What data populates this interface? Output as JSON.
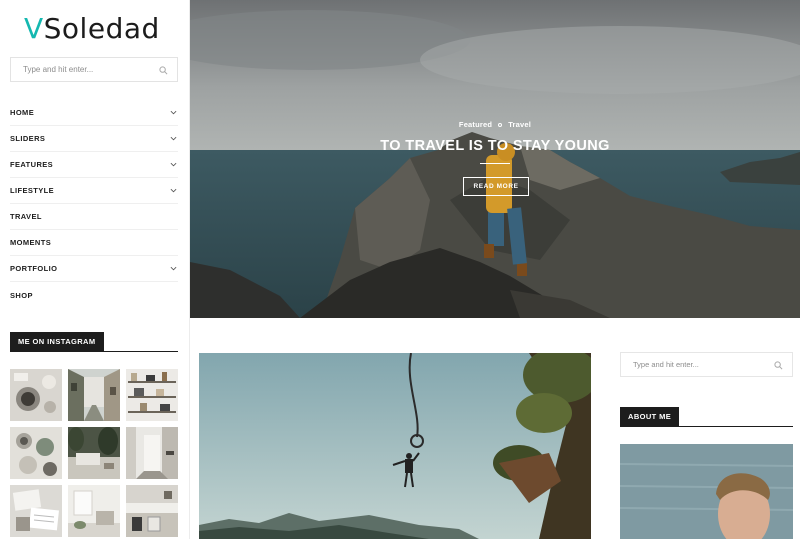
{
  "logo": {
    "first": "V",
    "rest": "Soledad"
  },
  "sidebar": {
    "search_placeholder": "Type and hit enter...",
    "menu": [
      {
        "label": "HOME",
        "has_dropdown": true
      },
      {
        "label": "SLIDERS",
        "has_dropdown": true
      },
      {
        "label": "FEATURES",
        "has_dropdown": true
      },
      {
        "label": "LIFESTYLE",
        "has_dropdown": true
      },
      {
        "label": "TRAVEL",
        "has_dropdown": false
      },
      {
        "label": "MOMENTS",
        "has_dropdown": false
      },
      {
        "label": "PORTFOLIO",
        "has_dropdown": true
      },
      {
        "label": "SHOP",
        "has_dropdown": false
      }
    ],
    "instagram_title": "ME ON INSTAGRAM"
  },
  "hero": {
    "categories": [
      "Featured",
      "Travel"
    ],
    "title": "TO TRAVEL IS TO STAY YOUNG",
    "button": "READ MORE"
  },
  "right_sidebar": {
    "search_placeholder": "Type and hit enter...",
    "about_title": "ABOUT ME"
  },
  "colors": {
    "accent": "#14b8b0",
    "dark": "#1d1d1d"
  },
  "icons": {
    "search": "search-icon",
    "dropdown": "chevron-down-icon"
  }
}
